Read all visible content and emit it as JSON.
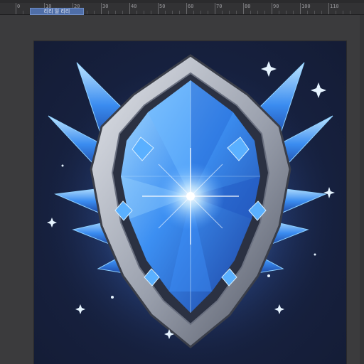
{
  "window": {
    "document_tab_label": "리리 일 리리"
  },
  "ruler": {
    "labels": [
      "0",
      "10",
      "20",
      "30",
      "40",
      "50",
      "60",
      "70",
      "80",
      "90",
      "100",
      "110"
    ]
  },
  "artwork": {
    "subject": "crystal-shield-emblem-icon",
    "colors": {
      "background": "#172242",
      "crystal_light": "#8fd0ff",
      "crystal_mid": "#2f86f0",
      "crystal_dark": "#1a3f9e",
      "frame_light": "#d7dbe2",
      "frame_dark": "#5d6270",
      "glow": "#bfe4ff"
    }
  }
}
